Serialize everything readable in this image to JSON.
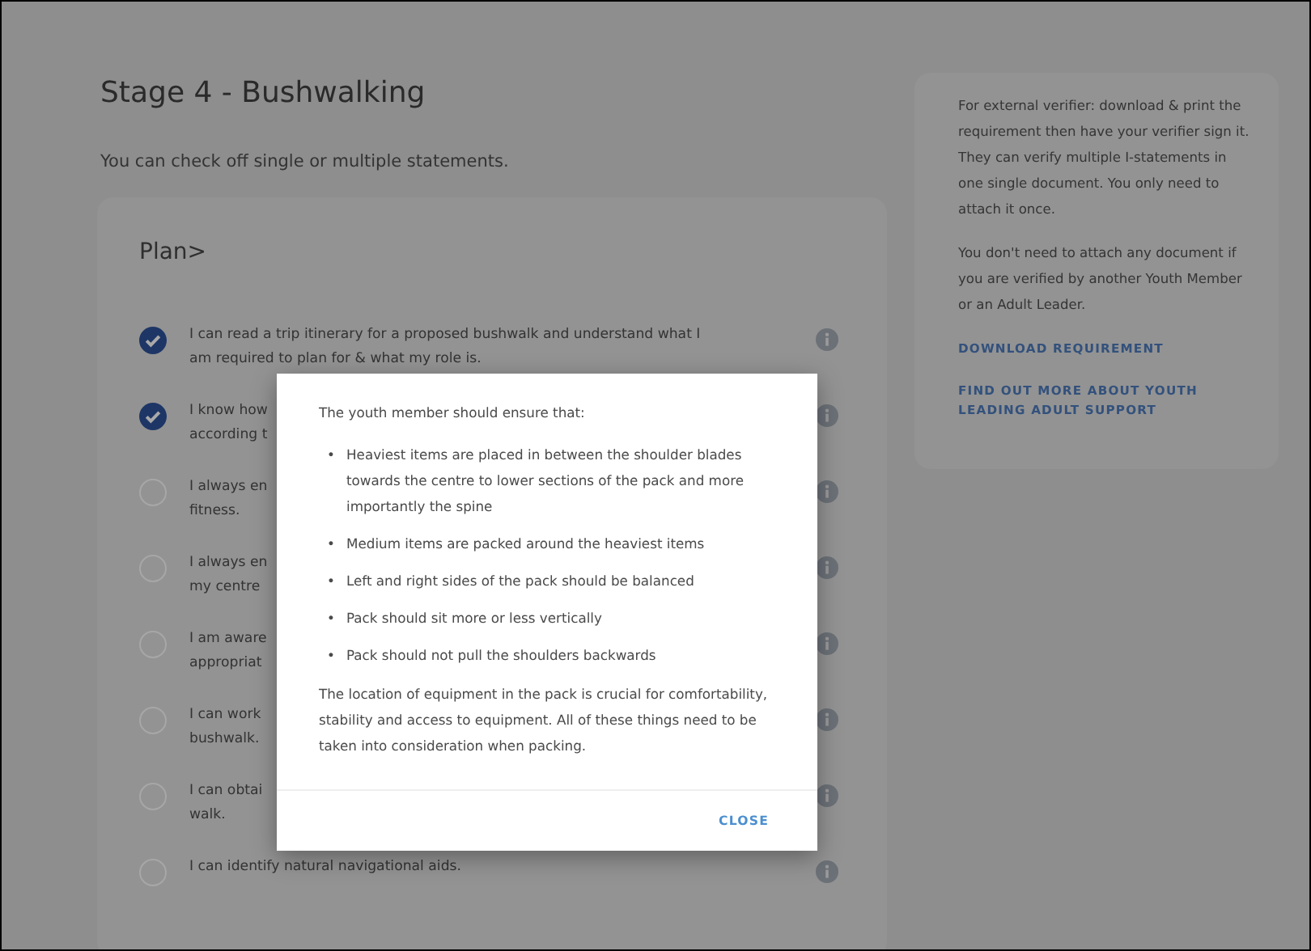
{
  "page": {
    "title": "Stage 4 - Bushwalking",
    "subtitle": "You can check off single or multiple statements."
  },
  "plan": {
    "heading": "Plan>",
    "items": [
      {
        "lines": [
          "I can read a trip itinerary for a proposed bushwalk and understand what I",
          "am required to plan for & what my role is."
        ],
        "checked": true
      },
      {
        "lines": [
          "I know how",
          "according t"
        ],
        "checked": true
      },
      {
        "lines": [
          "I always en",
          "fitness."
        ],
        "checked": false
      },
      {
        "lines": [
          "I always en",
          "my centre"
        ],
        "checked": false
      },
      {
        "lines": [
          "I am aware",
          "appropriat"
        ],
        "checked": false
      },
      {
        "lines": [
          "I can work",
          "bushwalk."
        ],
        "checked": false
      },
      {
        "lines": [
          "I can obtai",
          "walk."
        ],
        "checked": false
      },
      {
        "lines": [
          "I can identify natural navigational aids."
        ],
        "checked": false
      }
    ]
  },
  "verifier": {
    "paragraphs": [
      "For external verifier: download & print the requirement then have your verifier sign it. They can verify multiple I-statements in one single document. You only need to attach it once.",
      "You don't need to attach any document if you are verified by another Youth Member or an Adult Leader."
    ],
    "links": [
      "DOWNLOAD REQUIREMENT",
      "FIND OUT MORE ABOUT YOUTH LEADING ADULT SUPPORT"
    ]
  },
  "modal": {
    "marker": "•",
    "intro": "The youth member should ensure that:",
    "bullets": [
      "Heaviest items are placed in between the shoulder blades towards the centre to lower sections of the pack and more importantly the spine",
      "Medium items are packed around the heaviest items",
      "Left and right sides of the pack should be balanced",
      "Pack should sit more or less vertically",
      "Pack should not pull the shoulders backwards"
    ],
    "closing": "The location of equipment in the pack is crucial for comfortability, stability and access to equipment. All of these things need to be taken into consideration when packing.",
    "button": "CLOSE"
  }
}
